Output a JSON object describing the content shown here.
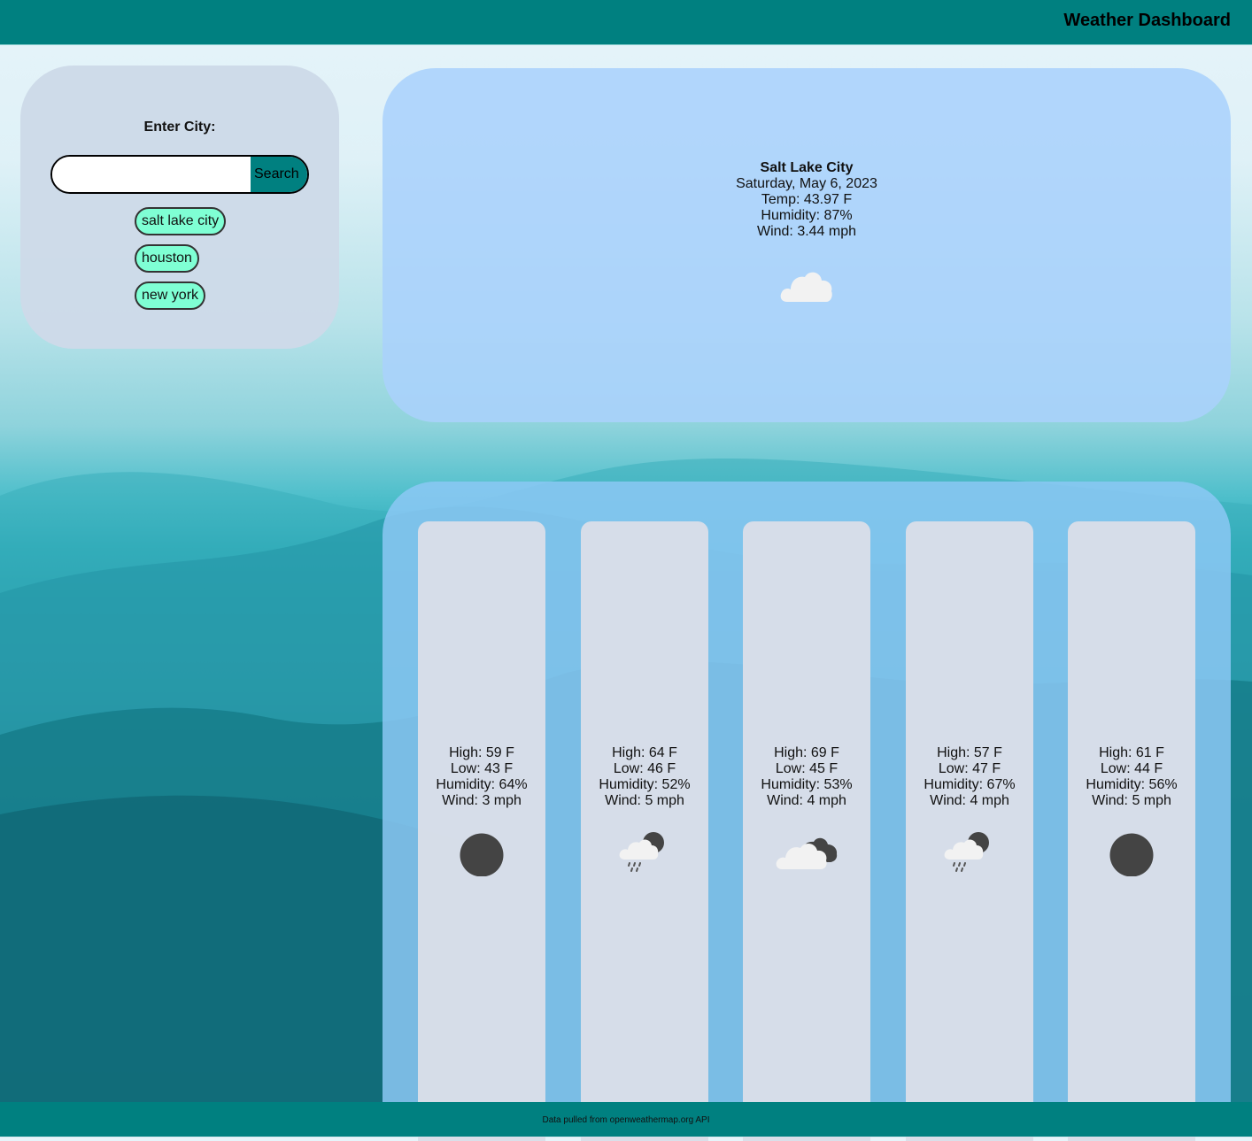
{
  "header": {
    "title": "Weather Dashboard"
  },
  "search": {
    "label": "Enter City:",
    "input_value": "",
    "button_label": "Search",
    "history": [
      "salt lake city",
      "houston",
      "new york"
    ]
  },
  "today": {
    "city": "Salt Lake City",
    "date": "Saturday, May 6, 2023",
    "temp": "Temp: 43.97 F",
    "humidity": "Humidity: 87%",
    "wind": "Wind: 3.44 mph",
    "icon": "cloud-icon"
  },
  "forecast": [
    {
      "high": "High: 59 F",
      "low": "Low: 43 F",
      "humidity": "Humidity: 64%",
      "wind": "Wind: 3 mph",
      "icon": "dark-circle-icon"
    },
    {
      "high": "High: 64 F",
      "low": "Low: 46 F",
      "humidity": "Humidity: 52%",
      "wind": "Wind: 5 mph",
      "icon": "rain-cloud-icon"
    },
    {
      "high": "High: 69 F",
      "low": "Low: 45 F",
      "humidity": "Humidity: 53%",
      "wind": "Wind: 4 mph",
      "icon": "broken-clouds-icon"
    },
    {
      "high": "High: 57 F",
      "low": "Low: 47 F",
      "humidity": "Humidity: 67%",
      "wind": "Wind: 4 mph",
      "icon": "rain-cloud-icon"
    },
    {
      "high": "High: 61 F",
      "low": "Low: 44 F",
      "humidity": "Humidity: 56%",
      "wind": "Wind: 5 mph",
      "icon": "dark-circle-icon"
    }
  ],
  "footer": {
    "text": "Data pulled from openweathermap.org API"
  },
  "colors": {
    "header": "#008080",
    "history_button": "#7fffd4",
    "search_button": "#008080"
  }
}
